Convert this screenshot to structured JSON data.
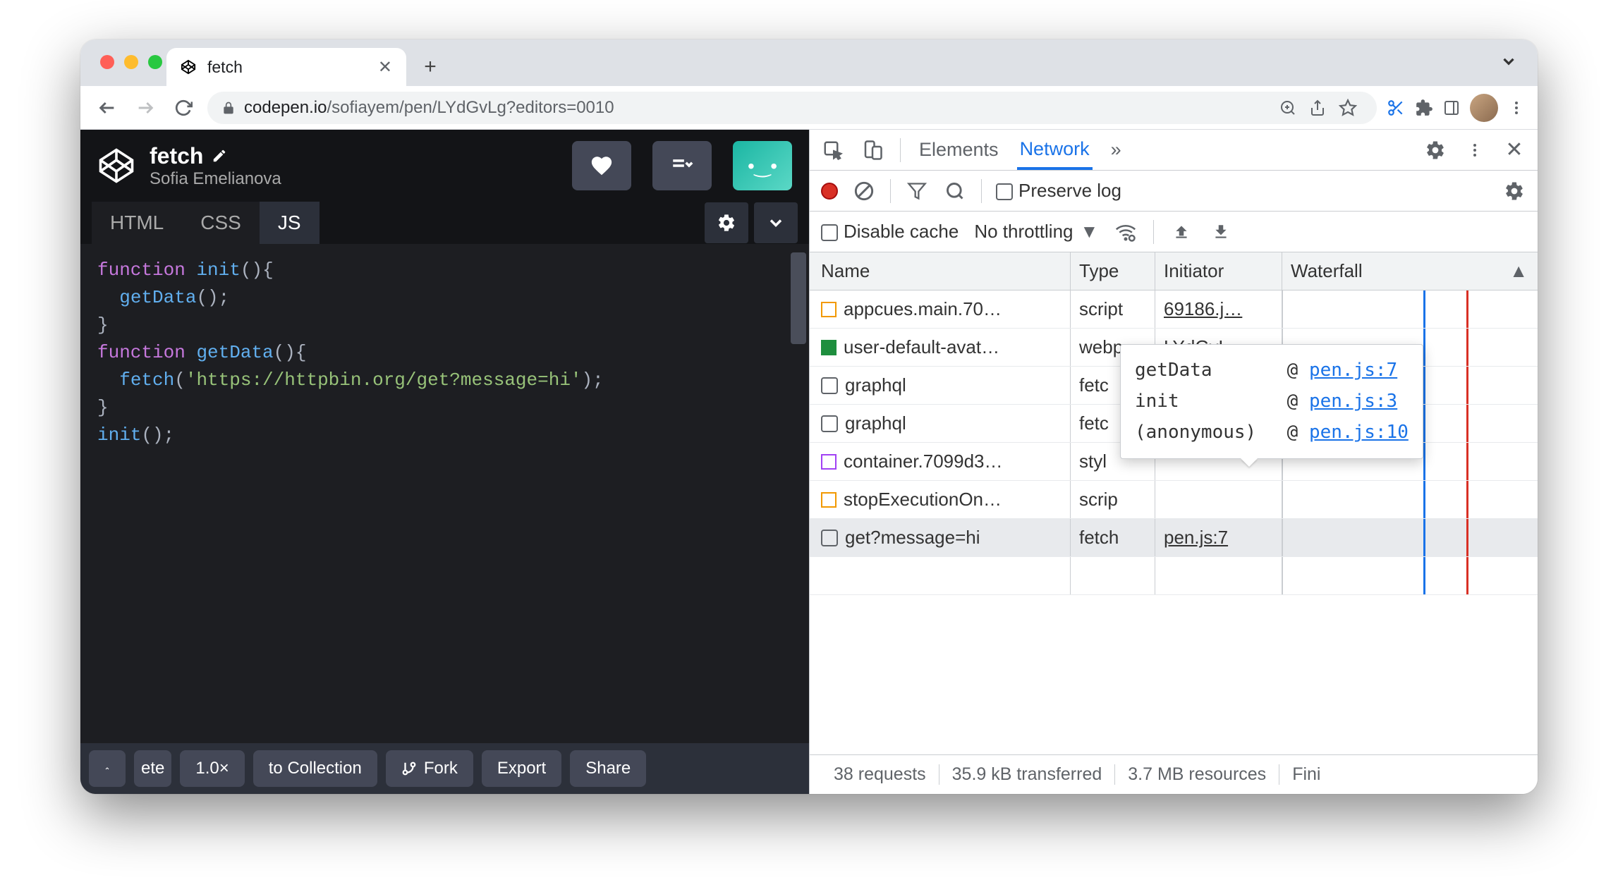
{
  "browser": {
    "tab_title": "fetch",
    "url_host": "codepen.io",
    "url_path": "/sofiayem/pen/LYdGvLg?editors=0010"
  },
  "codepen": {
    "title": "fetch",
    "author": "Sofia Emelianova",
    "tabs": {
      "html": "HTML",
      "css": "CSS",
      "js": "JS"
    },
    "code_lines": [
      {
        "kw": "function ",
        "fn": "init",
        "rest": "(){"
      },
      {
        "indent": "  ",
        "fn": "getData",
        "rest": "();"
      },
      {
        "rest": "}"
      },
      {
        "rest": ""
      },
      {
        "kw": "function ",
        "fn": "getData",
        "rest": "(){"
      },
      {
        "indent": "  ",
        "fn": "fetch",
        "rest_open": "(",
        "str": "'https://httpbin.org/get?message=hi'",
        "rest_close": ");"
      },
      {
        "rest": "}"
      },
      {
        "rest": ""
      },
      {
        "fn": "init",
        "rest": "();"
      }
    ],
    "footer": {
      "delete_frag": "ete",
      "zoom": "1.0×",
      "to_collection": "to Collection",
      "fork": "Fork",
      "export": "Export",
      "share": "Share"
    }
  },
  "devtools": {
    "tabs": {
      "elements": "Elements",
      "network": "Network",
      "more": "»"
    },
    "toolbar1": {
      "preserve_log": "Preserve log"
    },
    "toolbar2": {
      "disable_cache": "Disable cache",
      "throttling": "No throttling"
    },
    "columns": {
      "name": "Name",
      "type": "Type",
      "initiator": "Initiator",
      "waterfall": "Waterfall"
    },
    "rows": [
      {
        "name": "appcues.main.70…",
        "type": "script",
        "initiator": "69186.j…",
        "icon": "js"
      },
      {
        "name": "user-default-avat…",
        "type": "webp",
        "initiator": "LYdGvL…",
        "icon": "webp"
      },
      {
        "name": "graphql",
        "type": "fetc",
        "initiator": "",
        "icon": "box"
      },
      {
        "name": "graphql",
        "type": "fetc",
        "initiator": "",
        "icon": "box"
      },
      {
        "name": "container.7099d3…",
        "type": "styl",
        "initiator": "",
        "icon": "css"
      },
      {
        "name": "stopExecutionOn…",
        "type": "scrip",
        "initiator": "",
        "icon": "js"
      },
      {
        "name": "get?message=hi",
        "type": "fetch",
        "initiator": "pen.js:7",
        "icon": "box",
        "selected": true
      }
    ],
    "tooltip": [
      {
        "fn": "getData",
        "loc": "pen.js:7"
      },
      {
        "fn": "init",
        "loc": "pen.js:3"
      },
      {
        "fn": "(anonymous)",
        "loc": "pen.js:10"
      }
    ],
    "status": {
      "requests": "38 requests",
      "transferred": "35.9 kB transferred",
      "resources": "3.7 MB resources",
      "finish": "Fini"
    }
  }
}
